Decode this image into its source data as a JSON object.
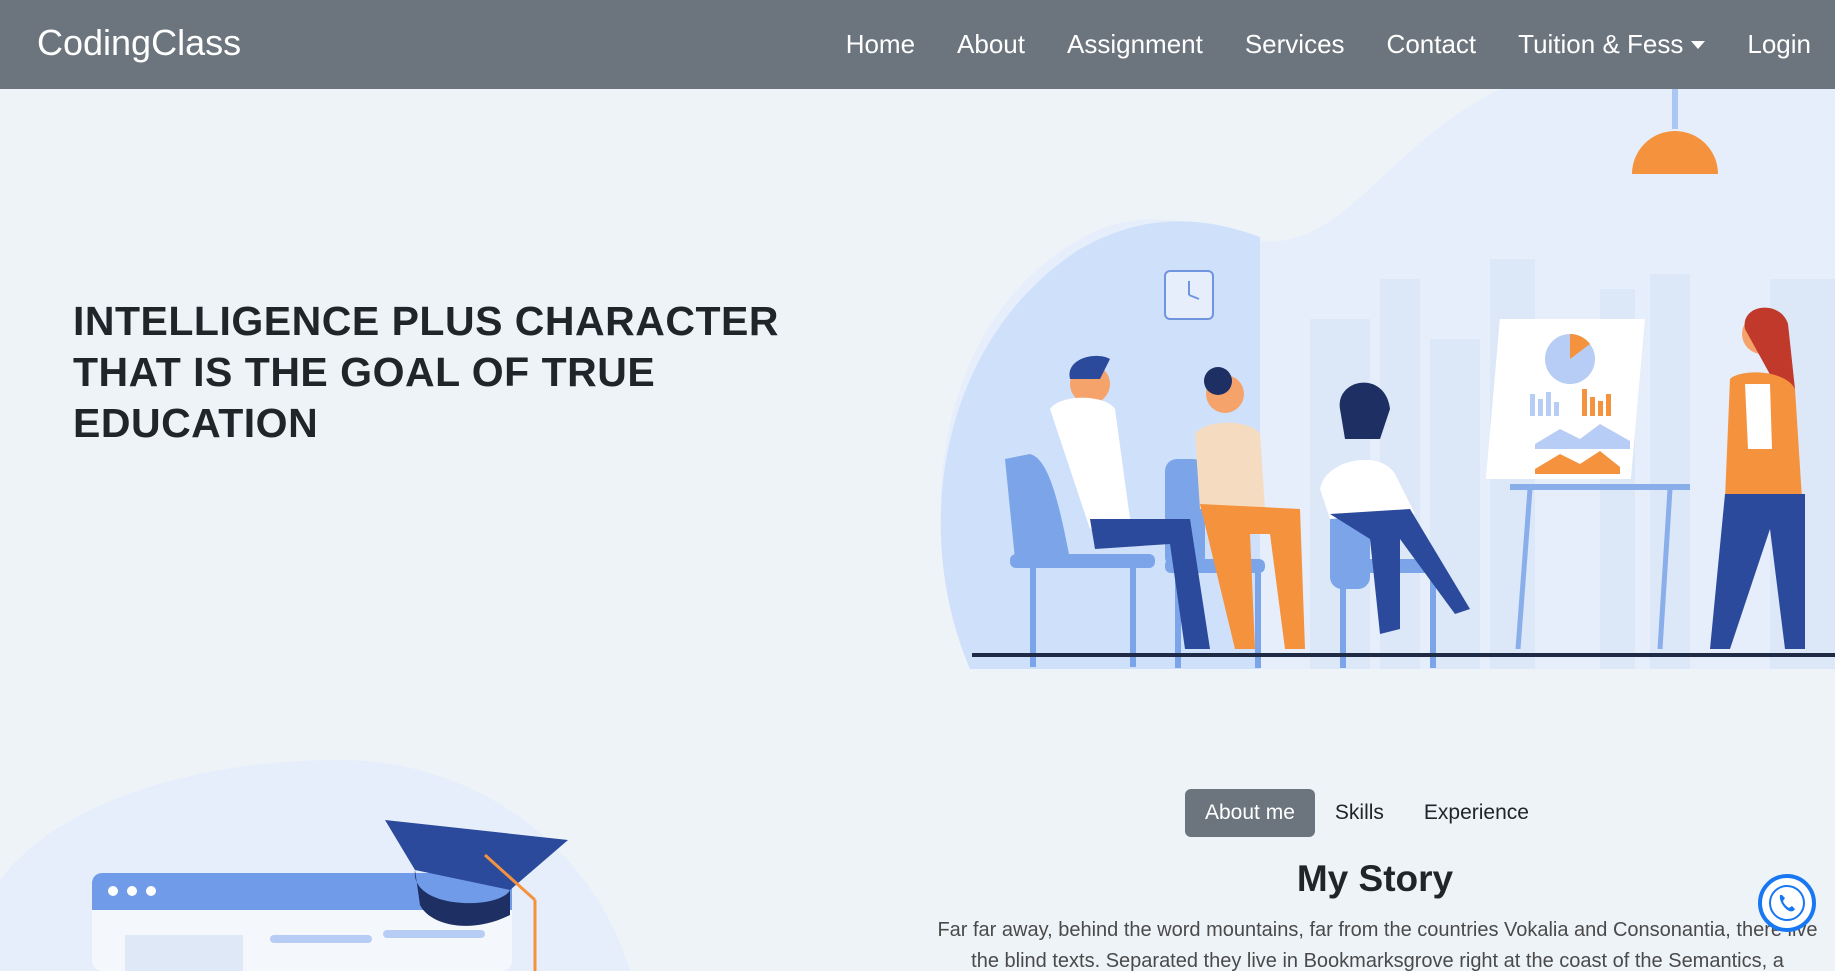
{
  "navbar": {
    "brand": "CodingClass",
    "links": [
      "Home",
      "About",
      "Assignment",
      "Services",
      "Contact"
    ],
    "dropdown_label": "Tuition & Fess",
    "login": "Login"
  },
  "hero": {
    "title": "INTELLIGENCE PLUS CHARACTER THAT IS THE GOAL OF TRUE EDUCATION"
  },
  "about": {
    "tabs": [
      "About me",
      "Skills",
      "Experience"
    ],
    "active_tab": "About me",
    "title": "My Story",
    "text": "Far far away, behind the word mountains, far from the countries Vokalia and Consonantia, there live the blind texts. Separated they live in Bookmarksgrove right at the coast of the Semantics, a"
  },
  "icons": {
    "whatsapp": "whatsapp-icon",
    "dropdown": "caret-down-icon"
  },
  "colors": {
    "navbar": "#6c757d",
    "background": "#eef3f8",
    "accent_orange": "#f5923e",
    "accent_blue": "#2b4a9c",
    "whatsapp_blue": "#1877f2"
  }
}
